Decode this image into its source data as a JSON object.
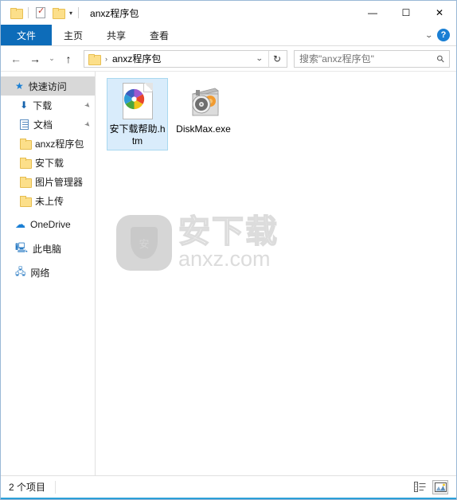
{
  "window": {
    "title": "anxz程序包",
    "quick_access_toolbar": [
      {
        "name": "folder-icon",
        "label": ""
      },
      {
        "name": "properties-icon",
        "label": ""
      },
      {
        "name": "new-folder-icon",
        "label": ""
      },
      {
        "name": "customize-chevron",
        "label": "▾"
      }
    ],
    "controls": {
      "minimize": "―",
      "maximize": "☐",
      "close": "✕"
    }
  },
  "ribbon": {
    "tabs": [
      {
        "label": "文件",
        "active": true
      },
      {
        "label": "主页",
        "active": false
      },
      {
        "label": "共享",
        "active": false
      },
      {
        "label": "查看",
        "active": false
      }
    ],
    "collapse_chevron": "⌄",
    "help_label": "?"
  },
  "navbar": {
    "back": "←",
    "forward": "→",
    "recent_chevron": "⌄",
    "up": "↑",
    "address": {
      "separator": "›",
      "path_text": "anxz程序包",
      "dropdown_chevron": "⌄",
      "refresh": "↻"
    },
    "search": {
      "placeholder": "搜索\"anxz程序包\"",
      "value": "",
      "icon": "search-icon"
    }
  },
  "sidebar": {
    "items": [
      {
        "label": "快速访问",
        "icon": "star-icon",
        "selected": true,
        "pinned": false,
        "indent": false
      },
      {
        "label": "下载",
        "icon": "download-arrow-icon",
        "selected": false,
        "pinned": true,
        "indent": true
      },
      {
        "label": "文档",
        "icon": "document-icon",
        "selected": false,
        "pinned": true,
        "indent": true
      },
      {
        "label": "anxz程序包",
        "icon": "folder-icon",
        "selected": false,
        "pinned": false,
        "indent": true
      },
      {
        "label": "安下载",
        "icon": "folder-icon",
        "selected": false,
        "pinned": false,
        "indent": true
      },
      {
        "label": "图片管理器",
        "icon": "folder-icon",
        "selected": false,
        "pinned": false,
        "indent": true
      },
      {
        "label": "未上传",
        "icon": "folder-icon",
        "selected": false,
        "pinned": false,
        "indent": true
      },
      {
        "label": "OneDrive",
        "icon": "cloud-icon",
        "selected": false,
        "pinned": false,
        "indent": false
      },
      {
        "label": "此电脑",
        "icon": "monitor-icon",
        "selected": false,
        "pinned": false,
        "indent": false
      },
      {
        "label": "网络",
        "icon": "network-icon",
        "selected": false,
        "pinned": false,
        "indent": false
      }
    ],
    "pin_glyph": "📌"
  },
  "files": [
    {
      "name": "安下载帮助.htm",
      "icon": "html-document-icon",
      "selected": true
    },
    {
      "name": "DiskMax.exe",
      "icon": "disk-application-icon",
      "selected": false
    }
  ],
  "watermark": {
    "shield_char": "安",
    "cn_text": "安下载",
    "en_text": "anxz.com"
  },
  "statusbar": {
    "item_count": "2 个项目",
    "views": [
      {
        "name": "details-view-button",
        "active": false
      },
      {
        "name": "large-icons-view-button",
        "active": true
      }
    ]
  },
  "colors": {
    "accent_blue": "#0d6cb9",
    "selection_blue": "#d9ecfb",
    "selection_border": "#a8d8f0",
    "sidebar_selected": "#d8d8d8",
    "folder_yellow": "#fcdf8a",
    "help_blue": "#1a7fd4",
    "bottom_accent": "#2b9fd8"
  }
}
